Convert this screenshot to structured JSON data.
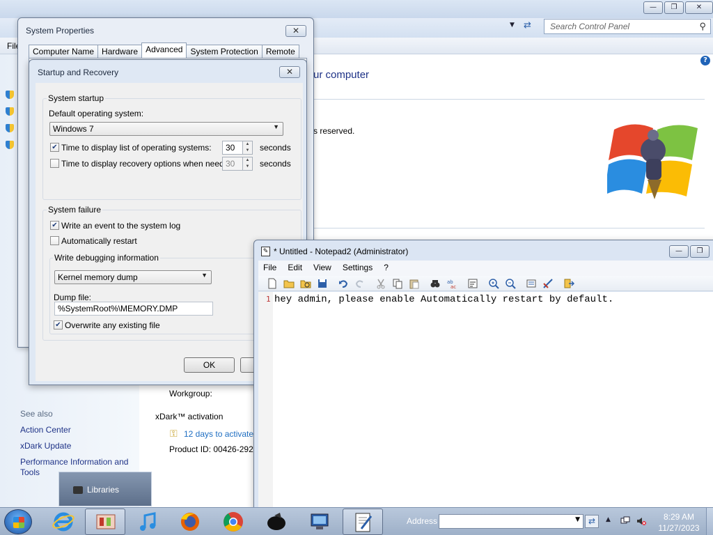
{
  "control_panel": {
    "search_placeholder": "Search Control Panel",
    "menu_file": "File",
    "heading": "ur computer",
    "copyright_fragment": "s reserved.",
    "see_also": "See also",
    "links": [
      "Action Center",
      "xDark Update",
      "Performance Information and",
      "Tools"
    ],
    "workgroup_label": "Workgroup:",
    "activation_title": "xDark™ activation",
    "activation_link": "12 days to activate",
    "product_id": "Product ID: 00426-292-",
    "libraries_label": "Libraries"
  },
  "system_properties": {
    "title": "System Properties",
    "tabs": [
      "Computer Name",
      "Hardware",
      "Advanced",
      "System Protection",
      "Remote"
    ],
    "active_tab": "Advanced"
  },
  "startup_recovery": {
    "title": "Startup and Recovery",
    "system_startup": {
      "group_label": "System startup",
      "default_os_label": "Default operating system:",
      "default_os_value": "Windows 7",
      "display_list_label": "Time to display list of operating systems:",
      "display_list_checked": true,
      "display_list_value": "30",
      "recovery_label": "Time to display recovery options when needed:",
      "recovery_checked": false,
      "recovery_value": "30",
      "seconds_unit": "seconds"
    },
    "system_failure": {
      "group_label": "System failure",
      "write_event_label": "Write an event to the system log",
      "write_event_checked": true,
      "auto_restart_label": "Automatically restart",
      "auto_restart_checked": false,
      "debug_group_label": "Write debugging information",
      "debug_value": "Kernel memory dump",
      "dump_file_label": "Dump file:",
      "dump_file_value": "%SystemRoot%\\MEMORY.DMP",
      "overwrite_label": "Overwrite any existing file",
      "overwrite_checked": true
    },
    "ok_label": "OK"
  },
  "notepad": {
    "title": "* Untitled - Notepad2 (Administrator)",
    "menus": [
      "File",
      "Edit",
      "View",
      "Settings",
      "?"
    ],
    "line_number": "1",
    "content": "hey admin, please enable Automatically restart by default."
  },
  "taskbar": {
    "address_label": "Address",
    "time": "8:29 AM",
    "date": "11/27/2023"
  },
  "check_mark": "✔",
  "colors": {
    "link": "#1e3287",
    "activation_link": "#1e6ec2",
    "taskbar": "#a9bad1"
  }
}
